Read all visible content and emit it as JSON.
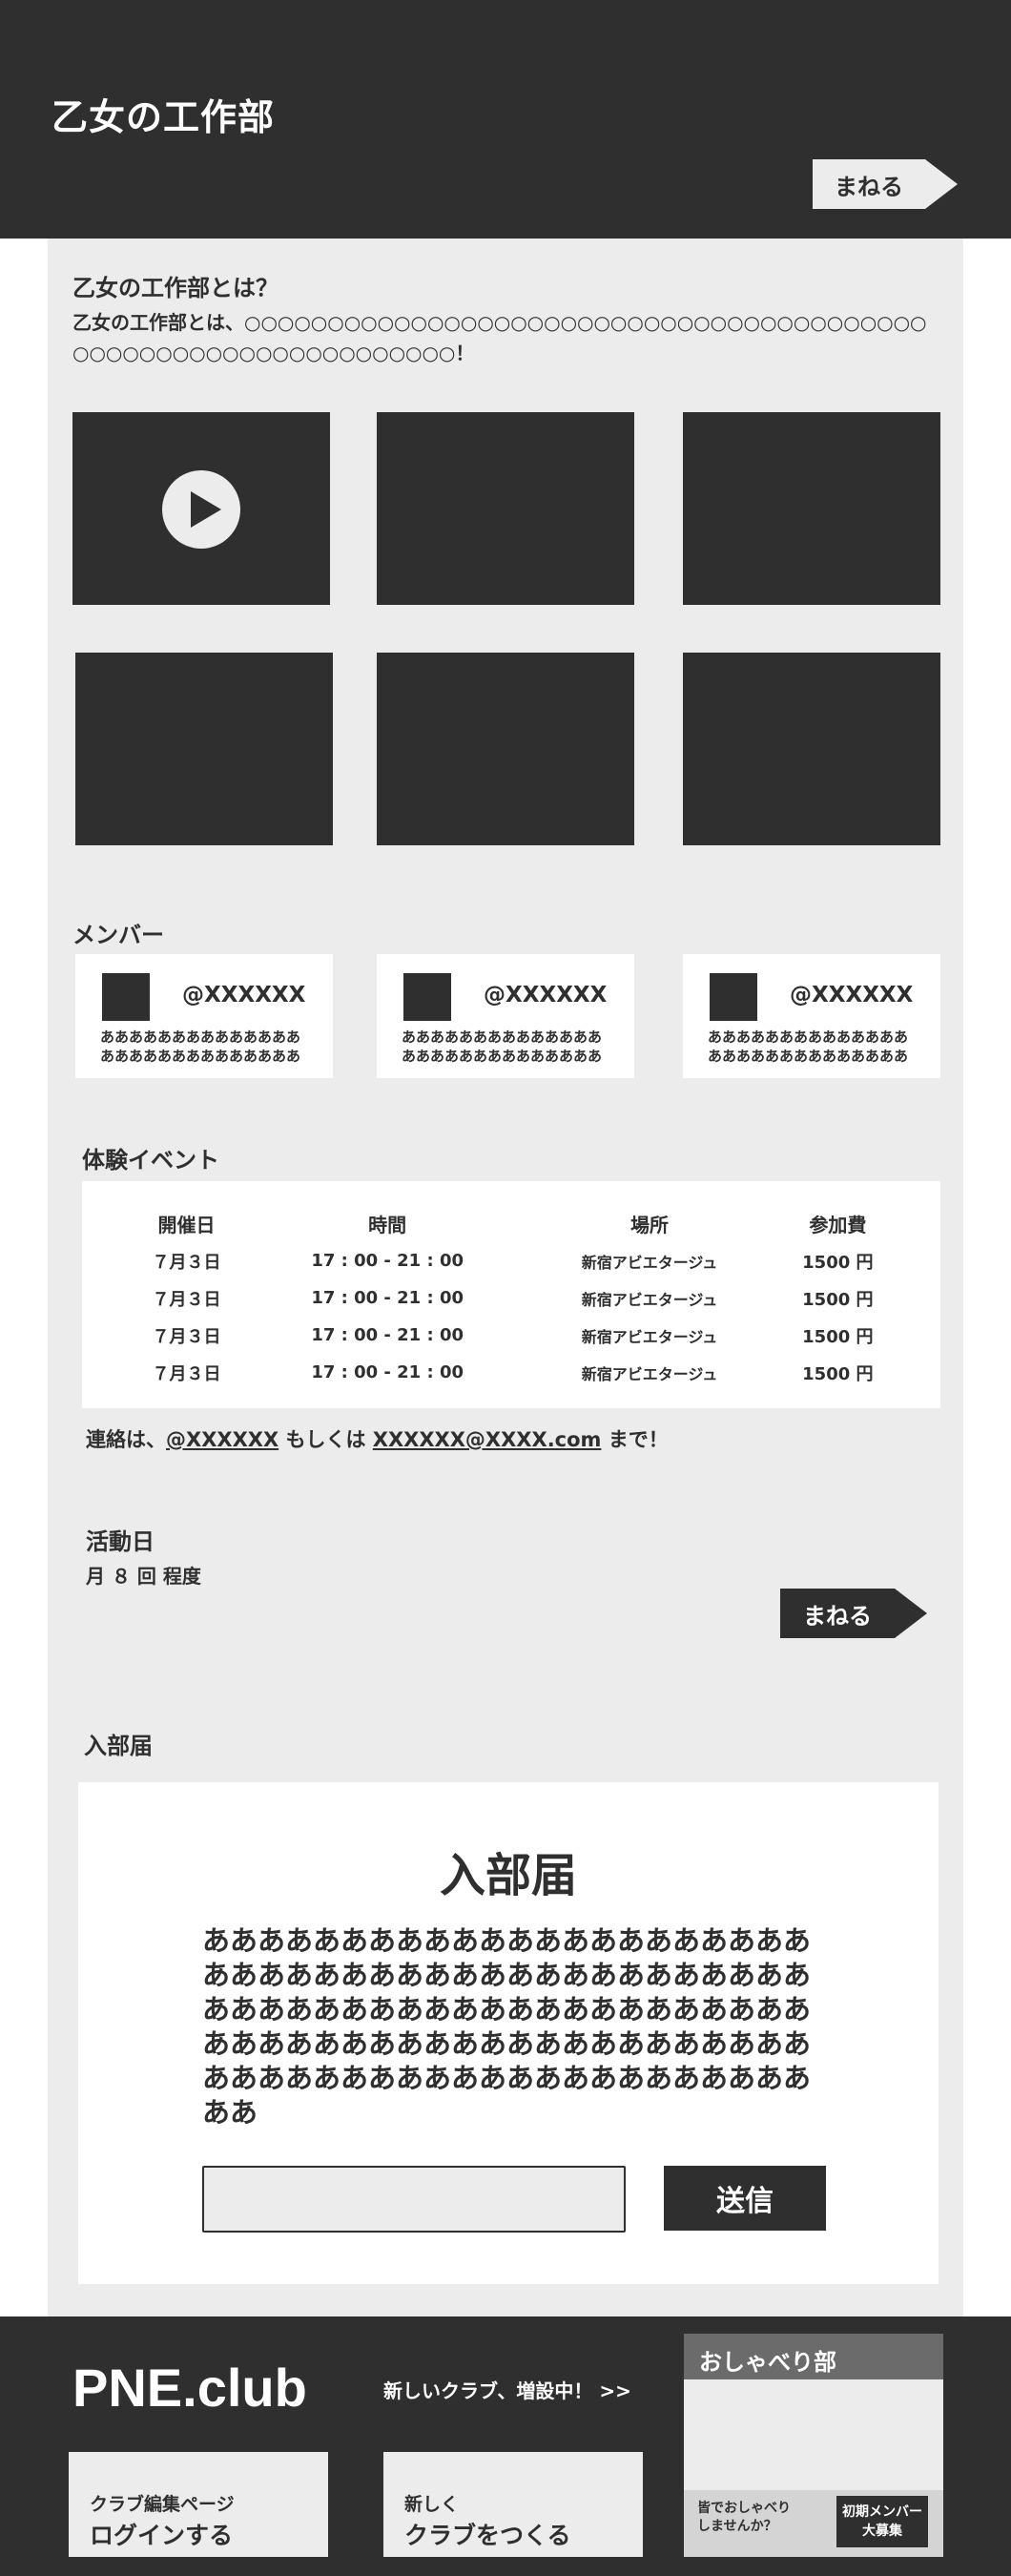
{
  "header": {
    "site_title": "乙女の工作部",
    "mane_label": "まねる"
  },
  "intro": {
    "title": "乙女の工作部とは？",
    "text": "乙女の工作部とは、○○○○○○○○○○○○○○○○○○○○○○○○○○○○○○○○○○○○○○○○○○○○○○○○○○○○○○○○○○○○○○○○！"
  },
  "members": {
    "title": "メンバー",
    "cards": [
      {
        "handle": "@XXXXXX",
        "bio": "ああああああああああああああああああああああああああああ"
      },
      {
        "handle": "@XXXXXX",
        "bio": "ああああああああああああああああああああああああああああ"
      },
      {
        "handle": "@XXXXXX",
        "bio": "ああああああああああああああああああああああああああああ"
      }
    ]
  },
  "events": {
    "title": "体験イベント",
    "headers": [
      "開催日",
      "時間",
      "場所",
      "参加費"
    ],
    "rows": [
      [
        "７月３日",
        "17 : 00 - 21 : 00",
        "新宿アビエタージュ",
        "1500 円"
      ],
      [
        "７月３日",
        "17 : 00 - 21 : 00",
        "新宿アビエタージュ",
        "1500 円"
      ],
      [
        "７月３日",
        "17 : 00 - 21 : 00",
        "新宿アビエタージュ",
        "1500 円"
      ],
      [
        "７月３日",
        "17 : 00 - 21 : 00",
        "新宿アビエタージュ",
        "1500 円"
      ]
    ],
    "contact_prefix": "連絡は、",
    "contact_handle": "@XXXXXX",
    "contact_middle": " もしくは ",
    "contact_email": "XXXXXX@XXXX.com",
    "contact_suffix": " まで！"
  },
  "activity": {
    "title": "活動日",
    "text": "月 ８ 回 程度",
    "mane_label": "まねる"
  },
  "form": {
    "section_title": "入部届",
    "heading": "入部届",
    "body": "ああああああああああああああああああああああああああああああああああああああああああああああああああああああああああああああああああああああああああああああああああああああああああああああああああああああああああああああああ",
    "input_value": "",
    "submit_label": "送信"
  },
  "footer": {
    "logo": "PNE.club",
    "promo": "新しいクラブ、増設中！ >>",
    "link1_small": "クラブ編集ページ",
    "link1_big": "ログインする",
    "link2_small": "新しく",
    "link2_big": "クラブをつくる"
  },
  "chat": {
    "title": "おしゃべり部",
    "invite_line1": "皆でおしゃべり",
    "invite_line2": "しませんか？",
    "recruit_line1": "初期メンバー",
    "recruit_line2": "大募集"
  },
  "colors": {
    "dark": "#2f2f2f",
    "light_gray": "#ececec",
    "white": "#ffffff"
  }
}
